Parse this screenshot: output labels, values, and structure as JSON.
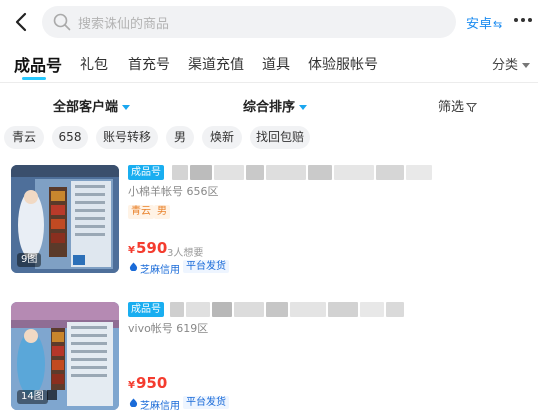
{
  "search": {
    "placeholder": "搜索诛仙的商品"
  },
  "header": {
    "platform_label": "安卓",
    "platform_swap_icon": "⇆",
    "more_icon": "more-icon"
  },
  "tabs": [
    {
      "label": "成品号",
      "active": true
    },
    {
      "label": "礼包",
      "active": false
    },
    {
      "label": "首充号",
      "active": false
    },
    {
      "label": "渠道充值",
      "active": false
    },
    {
      "label": "道具",
      "active": false
    },
    {
      "label": "体验服帐号",
      "active": false
    }
  ],
  "classify_label": "分类",
  "filters": {
    "client": "全部客户端",
    "sort": "综合排序",
    "screen": "筛选"
  },
  "chips": [
    "青云",
    "658",
    "账号转移",
    "男",
    "焕新",
    "找回包赔"
  ],
  "colors": {
    "accent": "#19aef0",
    "price": "#f43c2f",
    "tag_text": "#e8812a"
  },
  "listings": [
    {
      "image_count": "9图",
      "type_tag": "成品号",
      "meta": "小棉羊帐号 656区",
      "attrs": [
        "青云",
        "男"
      ],
      "price_symbol": "¥",
      "price": "590",
      "wants": "3人想要",
      "services": [
        "芝麻信用",
        "平台发货"
      ]
    },
    {
      "image_count": "14图",
      "type_tag": "成品号",
      "meta": "vivo帐号 619区",
      "attrs": [],
      "price_symbol": "¥",
      "price": "950",
      "wants": "",
      "services": [
        "芝麻信用",
        "平台发货"
      ]
    }
  ]
}
